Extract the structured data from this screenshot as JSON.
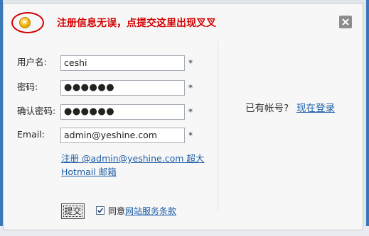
{
  "annotation": {
    "text": "注册信息无误，点提交这里出现叉叉",
    "icon": "warning-circle-icon",
    "color": "#d40000"
  },
  "form": {
    "username_label": "用户名:",
    "username_value": "ceshi",
    "password_label": "密码:",
    "password_value": "●●●●●●",
    "confirm_label": "确认密码:",
    "confirm_value": "●●●●●●",
    "email_label": "Email:",
    "email_value": "admin@yeshine.com",
    "required_mark": "*",
    "hint_text": "注册  @admin@yeshine.com 超大 Hotmail 邮箱"
  },
  "actions": {
    "submit_label": "提交",
    "agree_prefix": "同意",
    "agree_link": "网站服务条款",
    "agree_checked": true
  },
  "login": {
    "prompt": "已有帐号?",
    "link": "现在登录"
  },
  "colors": {
    "link": "#1f5fa8",
    "close_button": "#8d8d8d"
  }
}
